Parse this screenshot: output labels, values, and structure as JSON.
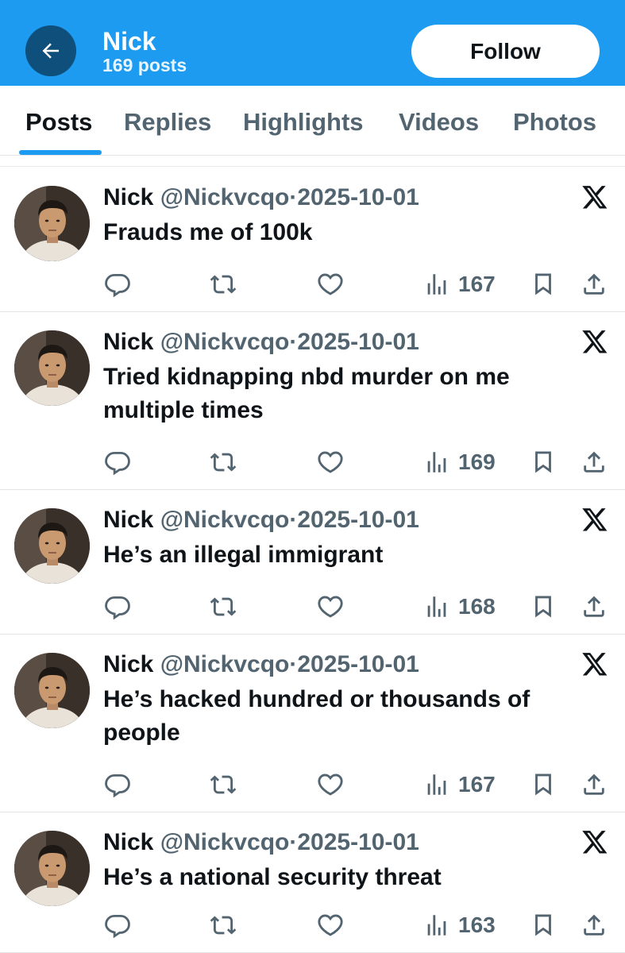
{
  "header": {
    "name": "Nick",
    "posts_count": "169 posts",
    "follow_label": "Follow",
    "accent_color": "#1d9bf0"
  },
  "tabs": [
    {
      "label": "Posts",
      "active": true
    },
    {
      "label": "Replies",
      "active": false
    },
    {
      "label": "Highlights",
      "active": false
    },
    {
      "label": "Videos",
      "active": false
    },
    {
      "label": "Photos",
      "active": false
    }
  ],
  "posts": [
    {
      "author": "Nick",
      "handle": "@Nickvcqo",
      "separator": "·",
      "date": "2025-10-01",
      "text_lines": [
        "Frauds me of 100k"
      ],
      "views": "167",
      "source_icon": "x-logo-icon"
    },
    {
      "author": "Nick",
      "handle": "@Nickvcqo",
      "separator": "·",
      "date": "2025-10-01",
      "text_lines": [
        "Tried kidnapping nbd murder on me",
        "multiple times"
      ],
      "views": "169",
      "source_icon": "x-logo-icon"
    },
    {
      "author": "Nick",
      "handle": "@Nickvcqo",
      "separator": "·",
      "date": "2025-10-01",
      "text_lines": [
        "He’s an illegal immigrant"
      ],
      "views": "168",
      "source_icon": "x-logo-icon"
    },
    {
      "author": "Nick",
      "handle": "@Nickvcqo",
      "separator": "·",
      "date": "2025-10-01",
      "text_lines": [
        "He’s hacked hundred or thousands of",
        "people"
      ],
      "views": "167",
      "source_icon": "x-logo-icon"
    },
    {
      "author": "Nick",
      "handle": "@Nickvcqo",
      "separator": "·",
      "date": "2025-10-01",
      "text_lines": [
        "He’s a national security threat"
      ],
      "views": "163",
      "source_icon": "x-logo-icon"
    }
  ]
}
